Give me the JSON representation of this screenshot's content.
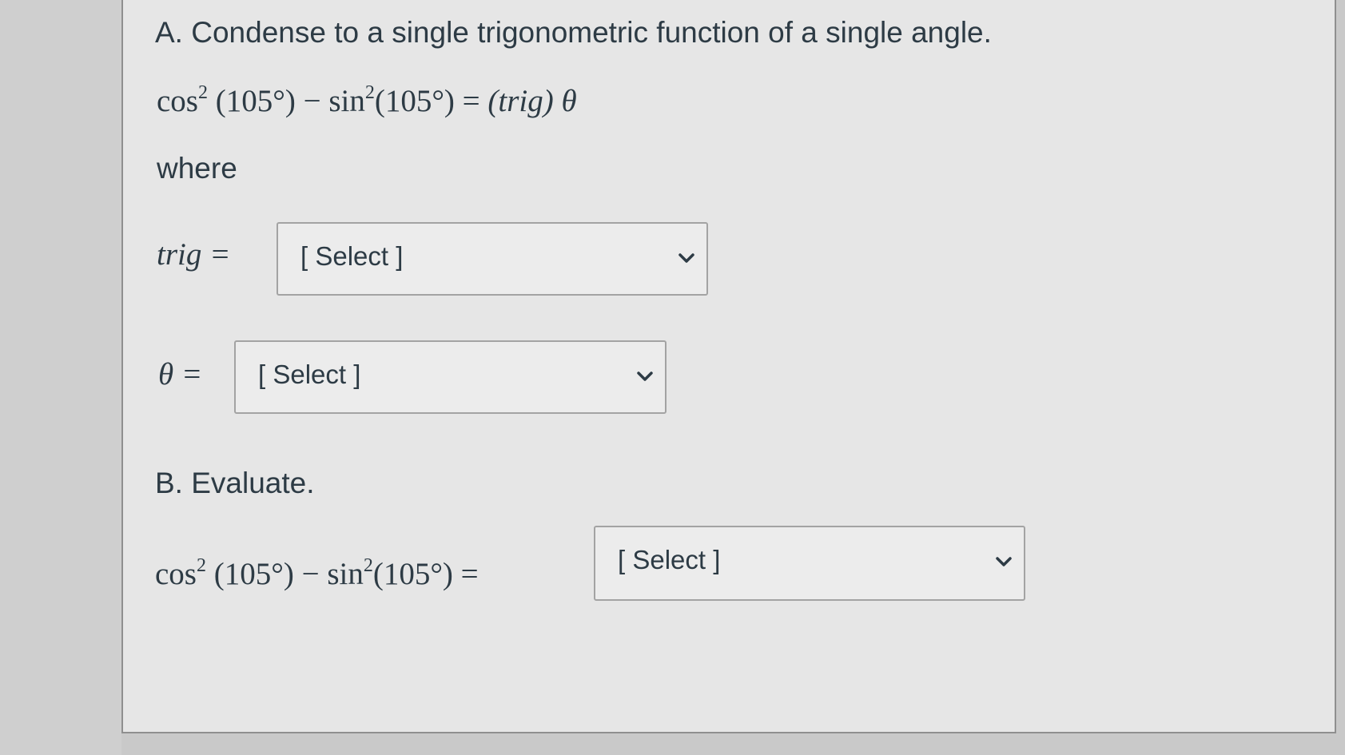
{
  "partA": {
    "heading": "A. Condense to a single trigonometric function of a single angle.",
    "equation": {
      "cos": "cos",
      "sin": "sin",
      "exp": "2",
      "angle": "(105°)",
      "minus": "−",
      "equals": "=",
      "rhs_trig": "(trig)",
      "rhs_theta": "θ"
    },
    "where_label": "where",
    "trig_label": "trig =",
    "theta_label": "θ =",
    "trig_select": "[ Select ]",
    "theta_select": "[ Select ]"
  },
  "partB": {
    "heading": "B. Evaluate.",
    "equation": {
      "cos": "cos",
      "sin": "sin",
      "exp": "2",
      "angle": "(105°)",
      "minus": "−",
      "equals": "="
    },
    "value_select": "[ Select ]"
  },
  "icons": {
    "dropdown": "chevron-down-icon"
  }
}
